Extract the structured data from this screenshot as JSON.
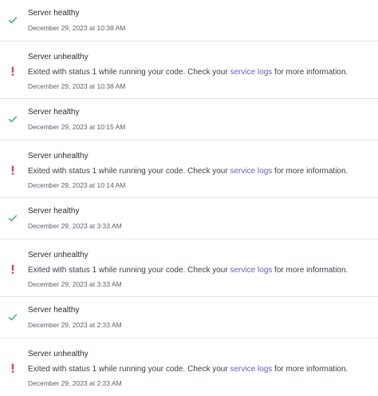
{
  "colors": {
    "healthy_icon": "#3fae7f",
    "unhealthy_icon": "#e23c66",
    "link": "#6a5bc6",
    "divider": "#e4e4e7"
  },
  "events": [
    {
      "type": "healthy",
      "icon": "check-icon",
      "title": "Server healthy",
      "timestamp": "December 29, 2023 at 10:38 AM"
    },
    {
      "type": "unhealthy",
      "icon": "exclamation-icon",
      "title": "Server unhealthy",
      "message_before": "Exited with status 1 while running your code. Check your ",
      "link_text": "service logs",
      "message_after": " for more information.",
      "timestamp": "December 29, 2023 at 10:38 AM"
    },
    {
      "type": "healthy",
      "icon": "check-icon",
      "title": "Server healthy",
      "timestamp": "December 29, 2023 at 10:15 AM"
    },
    {
      "type": "unhealthy",
      "icon": "exclamation-icon",
      "title": "Server unhealthy",
      "message_before": "Exited with status 1 while running your code. Check your ",
      "link_text": "service logs",
      "message_after": " for more information.",
      "timestamp": "December 29, 2023 at 10:14 AM"
    },
    {
      "type": "healthy",
      "icon": "check-icon",
      "title": "Server healthy",
      "timestamp": "December 29, 2023 at 3:33 AM"
    },
    {
      "type": "unhealthy",
      "icon": "exclamation-icon",
      "title": "Server unhealthy",
      "message_before": "Exited with status 1 while running your code. Check your ",
      "link_text": "service logs",
      "message_after": " for more information.",
      "timestamp": "December 29, 2023 at 3:33 AM"
    },
    {
      "type": "healthy",
      "icon": "check-icon",
      "title": "Server healthy",
      "timestamp": "December 29, 2023 at 2:33 AM"
    },
    {
      "type": "unhealthy",
      "icon": "exclamation-icon",
      "title": "Server unhealthy",
      "message_before": "Exited with status 1 while running your code. Check your ",
      "link_text": "service logs",
      "message_after": " for more information.",
      "timestamp": "December 29, 2023 at 2:33 AM"
    }
  ]
}
